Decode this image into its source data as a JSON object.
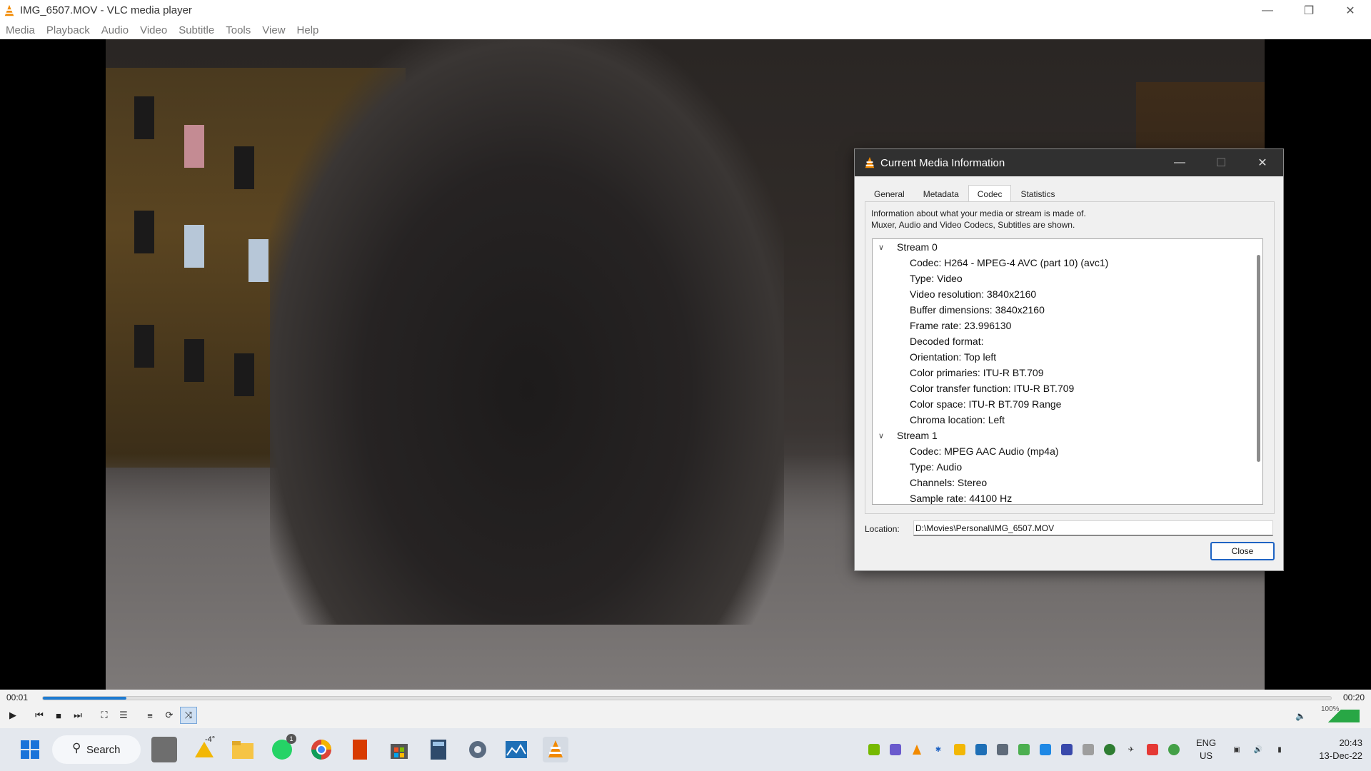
{
  "window": {
    "title": "IMG_6507.MOV - VLC media player",
    "minimize_icon": "minimize-icon",
    "restore_icon": "restore-icon",
    "close_icon": "close-icon"
  },
  "menubar": {
    "items": [
      "Media",
      "Playback",
      "Audio",
      "Video",
      "Subtitle",
      "Tools",
      "View",
      "Help"
    ]
  },
  "player": {
    "elapsed": "00:01",
    "total": "00:20",
    "progress_fraction": 0.065,
    "volume_label": "100%",
    "volume_fraction": 1.0,
    "buttons": [
      "play-icon",
      "previous-icon",
      "stop-icon",
      "next-icon",
      "fullscreen-icon",
      "extended-settings-icon",
      "playlist-icon",
      "loop-icon",
      "random-icon"
    ]
  },
  "dialog": {
    "title": "Current Media Information",
    "tabs": [
      "General",
      "Metadata",
      "Codec",
      "Statistics"
    ],
    "active_tab": "Codec",
    "description_line1": "Information about what your media or stream is made of.",
    "description_line2": "Muxer, Audio and Video Codecs, Subtitles are shown.",
    "tree": [
      {
        "label": "Stream 0",
        "level": 0
      },
      {
        "label": "Codec: H264 - MPEG-4 AVC (part 10) (avc1)",
        "level": 1
      },
      {
        "label": "Type: Video",
        "level": 1
      },
      {
        "label": "Video resolution: 3840x2160",
        "level": 1
      },
      {
        "label": "Buffer dimensions: 3840x2160",
        "level": 1
      },
      {
        "label": "Frame rate: 23.996130",
        "level": 1
      },
      {
        "label": "Decoded format:",
        "level": 1
      },
      {
        "label": "Orientation: Top left",
        "level": 1
      },
      {
        "label": "Color primaries: ITU-R BT.709",
        "level": 1
      },
      {
        "label": "Color transfer function: ITU-R BT.709",
        "level": 1
      },
      {
        "label": "Color space: ITU-R BT.709 Range",
        "level": 1
      },
      {
        "label": "Chroma location: Left",
        "level": 1
      },
      {
        "label": "Stream 1",
        "level": 0
      },
      {
        "label": "Codec: MPEG AAC Audio (mp4a)",
        "level": 1
      },
      {
        "label": "Type: Audio",
        "level": 1
      },
      {
        "label": "Channels: Stereo",
        "level": 1
      },
      {
        "label": "Sample rate: 44100 Hz",
        "level": 1
      }
    ],
    "location_label": "Location:",
    "location_value": "D:\\Movies\\Personal\\IMG_6507.MOV",
    "close_label": "Close"
  },
  "taskbar": {
    "search_label": "Search",
    "weather": "-4°",
    "whatsapp_badge": "1",
    "lang_line1": "ENG",
    "lang_line2": "US",
    "time": "20:43",
    "date": "13-Dec-22"
  },
  "colors": {
    "accent": "#1e7bd1",
    "vlc_orange": "#f28a00",
    "dialog_title_bg": "#303030",
    "close_btn_border": "#1e63c3"
  }
}
